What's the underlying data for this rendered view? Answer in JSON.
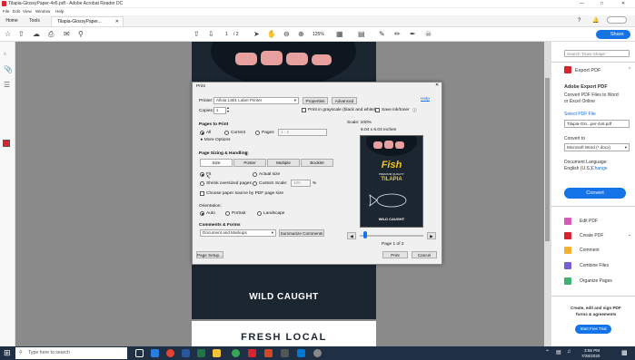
{
  "window": {
    "title": "Tilapia-GlossyPaper-4x6.pdf - Adobe Acrobat Reader DC"
  },
  "menu": [
    "File",
    "Edit",
    "View",
    "Window",
    "Help"
  ],
  "tabs": {
    "home": "Home",
    "tools": "Tools",
    "doc": "Tilapia-GlossyPaper..."
  },
  "toolbar": {
    "page_current": "1",
    "page_total": "/ 2",
    "zoom": "125%",
    "share": "Share"
  },
  "poster": {
    "wild_caught": "WILD CAUGHT",
    "fresh_local": "FRESH LOCAL"
  },
  "right_panel": {
    "search_placeholder": "Search 'Draw Shape'",
    "export_pdf_header": "Export PDF",
    "adobe_export_title": "Adobe Export PDF",
    "adobe_export_desc1": "Convert PDF Files to Word",
    "adobe_export_desc2": "or Excel Online",
    "select_pdf_label": "Select PDF File",
    "file_name": "Tilapia-Glo...per-4x6.pdf",
    "convert_to_label": "Convert to",
    "convert_to_value": "Microsoft Word (*.docx)",
    "doc_language_label": "Document Language:",
    "doc_language_value": "English (U.S.)",
    "change_link": "Change",
    "convert_button": "Convert",
    "tools": [
      "Edit PDF",
      "Create PDF",
      "Comment",
      "Combine Files",
      "Organize Pages"
    ],
    "promo1": "Create, edit and sign PDF",
    "promo2": "forms & agreements",
    "trial_button": "Start Free Trial"
  },
  "print": {
    "title": "Print",
    "help": "Help",
    "printer_label": "Printer:",
    "printer_value": "Afinia L801 Label Printer",
    "properties": "Properties",
    "advanced": "Advanced",
    "copies_label": "Copies:",
    "copies_value": "1",
    "grayscale": "Print in grayscale (black and white)",
    "save_ink": "Save ink/toner",
    "pages_header": "Pages to Print",
    "all": "All",
    "current": "Current",
    "pages": "Pages",
    "pages_value": "1 - 2",
    "more_options": "More Options",
    "sizing_header": "Page Sizing & Handling",
    "size_btn": "Size",
    "poster_btn": "Poster",
    "multiple_btn": "Multiple",
    "booklet_btn": "Booklet",
    "fit": "Fit",
    "actual_size": "Actual size",
    "shrink": "Shrink oversized pages",
    "custom_scale": "Custom Scale:",
    "custom_scale_value": "100",
    "percent": "%",
    "choose_source": "Choose paper source by PDF page size",
    "orientation_label": "Orientation:",
    "auto": "Auto",
    "portrait": "Portrait",
    "landscape": "Landscape",
    "comments_header": "Comments & Forms",
    "comments_value": "Document and Markups",
    "summarize": "Summarize Comments",
    "scale": "Scale: 100%",
    "dims": "6.04 x 6.04 Inches",
    "preview_fish": "Fish",
    "preview_premium": "PREMIUM QUALITY",
    "preview_tilapia": "TILAPIA",
    "preview_wild": "WILD CAUGHT",
    "page_of": "Page 1 of 2",
    "page_setup": "Page Setup...",
    "print_btn": "Print",
    "cancel_btn": "Cancel"
  },
  "taskbar": {
    "search_placeholder": "Type here to search",
    "time": "3:55 PM",
    "date": "7/28/2020"
  },
  "colors": {
    "accent": "#1473e6",
    "acrobat_red": "#d9232e",
    "taskbar": "#1f2f44",
    "poster_bg": "#1c2631",
    "fish_yellow": "#f2c418"
  }
}
